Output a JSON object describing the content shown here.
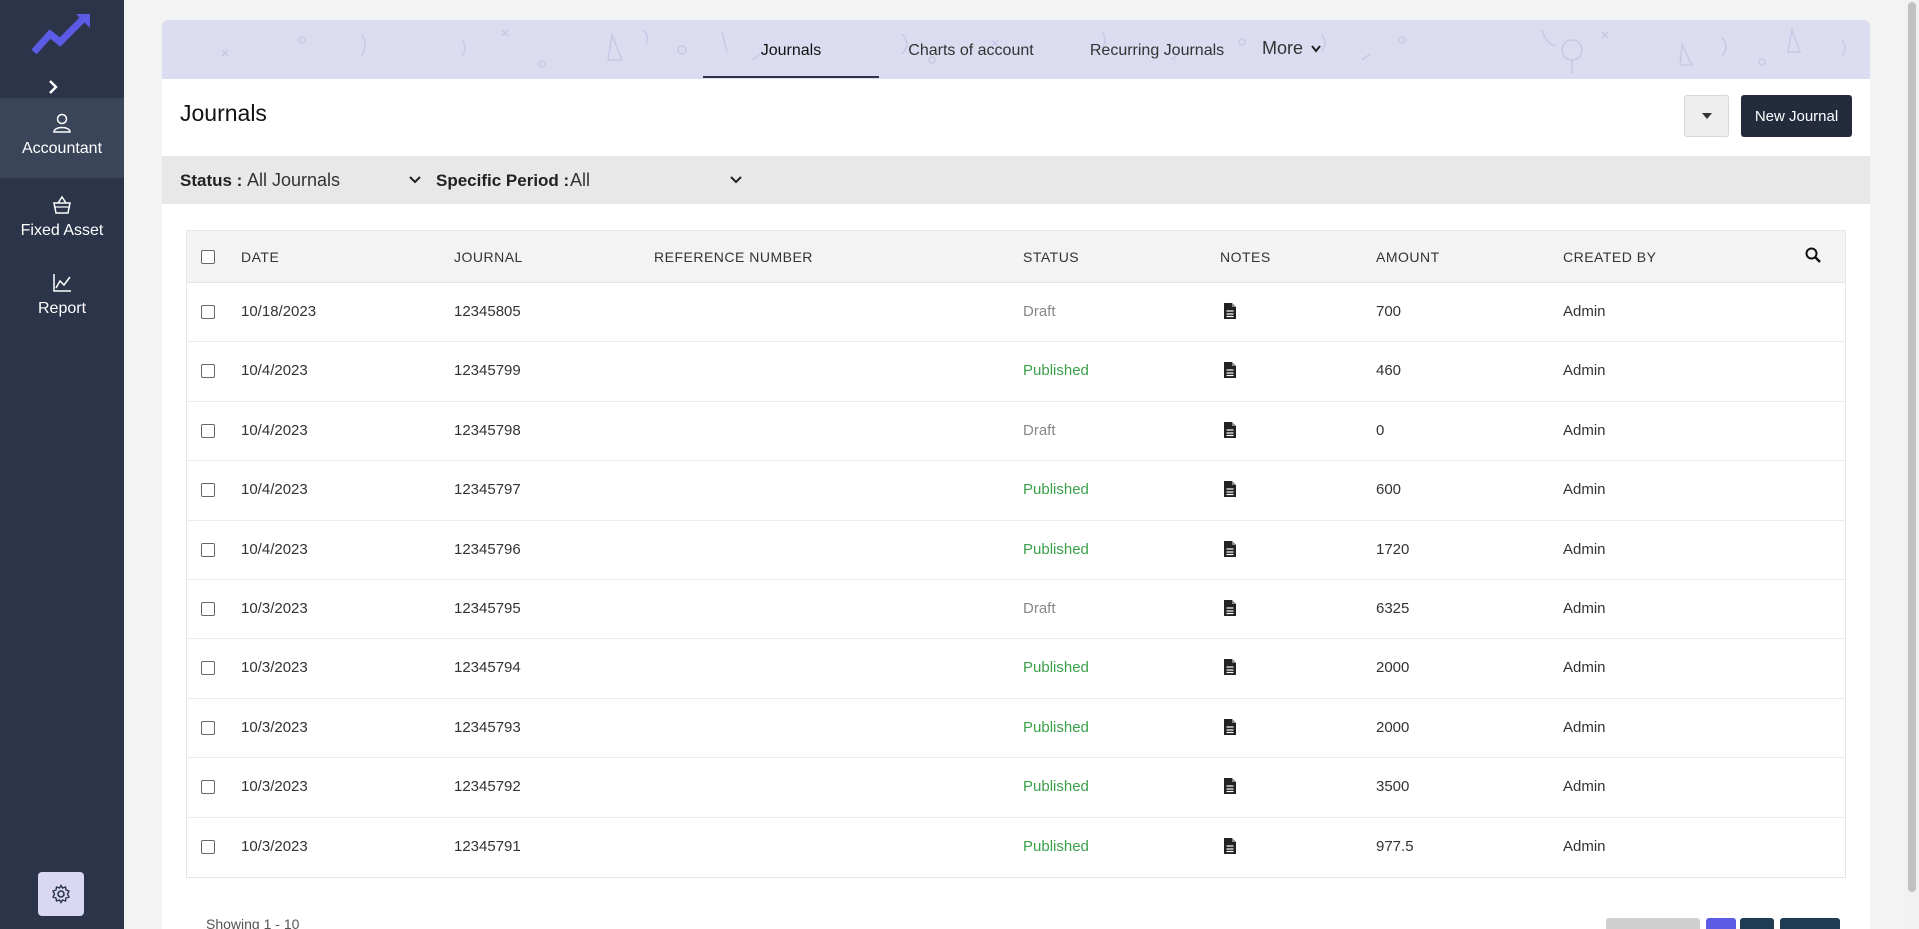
{
  "sidebar": {
    "items": [
      {
        "label": "Accountant",
        "icon": "user-icon",
        "active": true
      },
      {
        "label": "Fixed Asset",
        "icon": "basket-icon",
        "active": false
      },
      {
        "label": "Report",
        "icon": "chart-line-icon",
        "active": false
      }
    ],
    "expand_icon": "chevron-right-icon",
    "settings_icon": "gear-icon"
  },
  "topnav": {
    "tabs": [
      {
        "label": "Journals",
        "active": true
      },
      {
        "label": "Charts of account",
        "active": false
      },
      {
        "label": "Recurring Journals",
        "active": false
      },
      {
        "label": "More",
        "active": false
      }
    ]
  },
  "header": {
    "title": "Journals",
    "new_button": "New Journal"
  },
  "filters": {
    "status_label": "Status :",
    "status_value": "All Journals",
    "period_label": "Specific Period :",
    "period_value": "All"
  },
  "table": {
    "columns": [
      "DATE",
      "JOURNAL",
      "REFERENCE NUMBER",
      "STATUS",
      "NOTES",
      "AMOUNT",
      "CREATED BY"
    ],
    "rows": [
      {
        "date": "10/18/2023",
        "journal": "12345805",
        "reference": "",
        "status": "Draft",
        "amount": "700",
        "created_by": "Admin"
      },
      {
        "date": "10/4/2023",
        "journal": "12345799",
        "reference": "",
        "status": "Published",
        "amount": "460",
        "created_by": "Admin"
      },
      {
        "date": "10/4/2023",
        "journal": "12345798",
        "reference": "",
        "status": "Draft",
        "amount": "0",
        "created_by": "Admin"
      },
      {
        "date": "10/4/2023",
        "journal": "12345797",
        "reference": "",
        "status": "Published",
        "amount": "600",
        "created_by": "Admin"
      },
      {
        "date": "10/4/2023",
        "journal": "12345796",
        "reference": "",
        "status": "Published",
        "amount": "1720",
        "created_by": "Admin"
      },
      {
        "date": "10/3/2023",
        "journal": "12345795",
        "reference": "",
        "status": "Draft",
        "amount": "6325",
        "created_by": "Admin"
      },
      {
        "date": "10/3/2023",
        "journal": "12345794",
        "reference": "",
        "status": "Published",
        "amount": "2000",
        "created_by": "Admin"
      },
      {
        "date": "10/3/2023",
        "journal": "12345793",
        "reference": "",
        "status": "Published",
        "amount": "2000",
        "created_by": "Admin"
      },
      {
        "date": "10/3/2023",
        "journal": "12345792",
        "reference": "",
        "status": "Published",
        "amount": "3500",
        "created_by": "Admin"
      },
      {
        "date": "10/3/2023",
        "journal": "12345791",
        "reference": "",
        "status": "Published",
        "amount": "977.5",
        "created_by": "Admin"
      }
    ]
  },
  "pagination": {
    "showing": "Showing 1 - 10"
  },
  "colors": {
    "sidebar_bg": "#2b3448",
    "sidebar_active": "#3b4559",
    "accent": "#5b5be6",
    "published": "#3aa04a",
    "draft": "#888888",
    "primary_button": "#232b3d"
  }
}
